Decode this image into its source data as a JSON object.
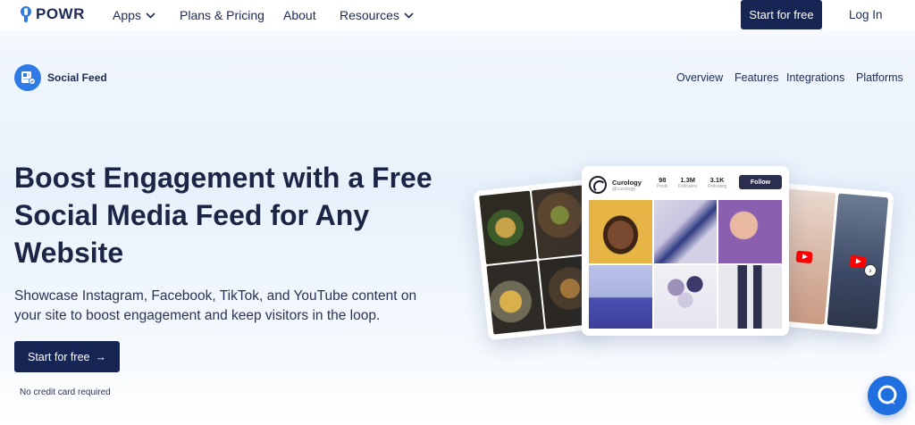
{
  "brand": {
    "name": "POWR"
  },
  "nav": {
    "items": [
      {
        "label": "Apps",
        "has_dropdown": true
      },
      {
        "label": "Plans & Pricing",
        "has_dropdown": false
      },
      {
        "label": "About",
        "has_dropdown": false
      },
      {
        "label": "Resources",
        "has_dropdown": true
      }
    ],
    "start_label": "Start for free",
    "login_label": "Log In"
  },
  "product": {
    "name": "Social Feed",
    "icon": "social-feed-app-icon"
  },
  "subnav": {
    "items": [
      "Overview",
      "Features",
      "Integrations",
      "Platforms"
    ]
  },
  "hero": {
    "title": "Boost Engagement with a Free Social Media Feed for Any Website",
    "subtitle": "Showcase Instagram, Facebook, TikTok, and YouTube content on your site to boost engagement and keep visitors in the loop.",
    "cta_label": "Start for free",
    "cta_arrow": "→",
    "note": "No credit card required"
  },
  "mockup": {
    "profile": {
      "name": "Curology",
      "handle": "@curology",
      "stats": [
        {
          "value": "98",
          "label": "Posts"
        },
        {
          "value": "1.3M",
          "label": "Followers"
        },
        {
          "value": "3.1K",
          "label": "Following"
        }
      ],
      "follow_label": "Follow"
    }
  },
  "colors": {
    "primary_dark": "#172554",
    "brand_blue": "#2f7be5",
    "chat_blue": "#1f6fe0",
    "text_dark": "#1b2545"
  },
  "chat": {
    "icon": "chat-bubble-icon"
  }
}
